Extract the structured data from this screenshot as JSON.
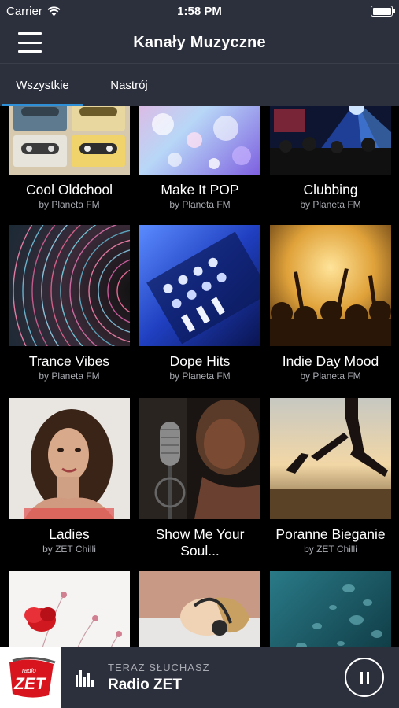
{
  "status_bar": {
    "carrier": "Carrier",
    "time": "1:58 PM",
    "icons": [
      "wifi-icon",
      "battery-icon"
    ]
  },
  "header": {
    "title": "Kanały Muzyczne",
    "menu_icon": "hamburger-menu-icon"
  },
  "tabs": [
    {
      "label": "Wszystkie",
      "active": true
    },
    {
      "label": "Nastrój",
      "active": false
    }
  ],
  "accent_color": "#2f8fd6",
  "channels": [
    {
      "name": "Cool Oldchool",
      "by": "by Planeta FM"
    },
    {
      "name": "Make It POP",
      "by": "by Planeta FM"
    },
    {
      "name": "Clubbing",
      "by": "by Planeta FM"
    },
    {
      "name": "Trance Vibes",
      "by": "by Planeta FM"
    },
    {
      "name": "Dope Hits",
      "by": "by Planeta FM"
    },
    {
      "name": "Indie Day Mood",
      "by": "by Planeta FM"
    },
    {
      "name": "Ladies",
      "by": "by ZET Chilli"
    },
    {
      "name": "Show Me Your Soul...",
      "by": ""
    },
    {
      "name": "Poranne Bieganie",
      "by": "by ZET Chilli"
    },
    {
      "name": "",
      "by": ""
    },
    {
      "name": "",
      "by": ""
    },
    {
      "name": "",
      "by": ""
    }
  ],
  "player": {
    "logo_small": "radio",
    "logo_text": "ZET",
    "now_playing_label": "TERAZ SŁUCHASZ",
    "station": "Radio ZET",
    "state": "playing",
    "pause_icon": "pause-icon"
  }
}
